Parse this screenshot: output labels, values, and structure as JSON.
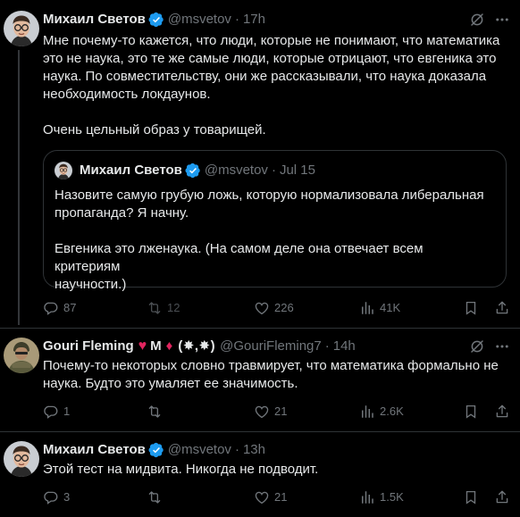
{
  "tweets": [
    {
      "author": "Михаил Светов",
      "handle": "@msvetov",
      "time": "17h",
      "text": "Мне почему-то кажется, что люди, которые не понимают, что математика\nэто не наука, это те же самые люди, которые отрицают, что евгеника это\nнаука. По совместительству, они же рассказывали, что наука доказала\nнеобходимость локдаунов.\n\nОчень цельный образ у товарищей.",
      "quote": {
        "author": "Михаил Светов",
        "handle": "@msvetov",
        "time": "Jul 15",
        "text": "Назовите самую грубую ложь, которую нормализовала либеральная\nпропаганда? Я начну.\n\nЕвгеника это лженаука. (На самом деле она отвечает всем критериям\nнаучности.)"
      },
      "replies": "87",
      "retweets": "12",
      "likes": "226",
      "views": "41K"
    },
    {
      "author": "Gouri Fleming",
      "author_suffix_m": "M",
      "author_symbols": "(✸,✸)",
      "handle": "@GouriFleming7",
      "time": "14h",
      "text": "Почему-то некоторых словно травмирует, что математика  формально не\nнаука. Будто это умаляет ее значимость.",
      "replies": "1",
      "retweets": "",
      "likes": "21",
      "views": "2.6K"
    },
    {
      "author": "Михаил Светов",
      "handle": "@msvetov",
      "time": "13h",
      "text": "Этой тест на мидвита. Никогда не подводит.",
      "replies": "3",
      "retweets": "",
      "likes": "21",
      "views": "1.5K"
    }
  ],
  "separator": "·",
  "colors": {
    "verified": "#1d9bf0",
    "muted": "#71767b",
    "background": "#000000",
    "text": "#e7e9ea",
    "heart": "#e0245e"
  },
  "icons": [
    "verified-badge-icon",
    "grok-icon",
    "more-icon",
    "reply-icon",
    "retweet-icon",
    "like-icon",
    "views-icon",
    "bookmark-icon",
    "share-icon",
    "heart-emoji",
    "diamond-emoji"
  ]
}
